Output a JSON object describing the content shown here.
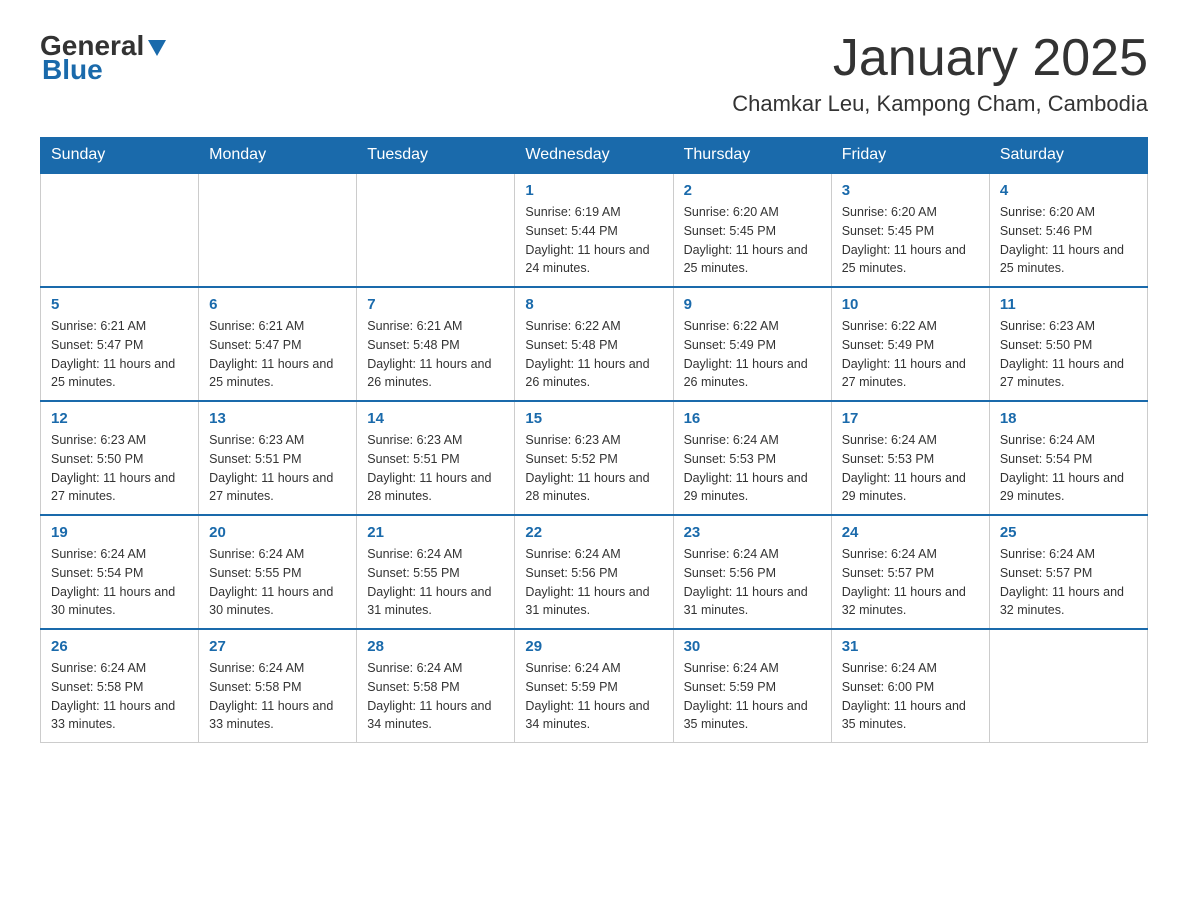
{
  "header": {
    "logo_general": "General",
    "logo_blue": "Blue",
    "month_title": "January 2025",
    "location": "Chamkar Leu, Kampong Cham, Cambodia"
  },
  "days_of_week": [
    "Sunday",
    "Monday",
    "Tuesday",
    "Wednesday",
    "Thursday",
    "Friday",
    "Saturday"
  ],
  "weeks": [
    [
      {
        "day": "",
        "info": ""
      },
      {
        "day": "",
        "info": ""
      },
      {
        "day": "",
        "info": ""
      },
      {
        "day": "1",
        "info": "Sunrise: 6:19 AM\nSunset: 5:44 PM\nDaylight: 11 hours and 24 minutes."
      },
      {
        "day": "2",
        "info": "Sunrise: 6:20 AM\nSunset: 5:45 PM\nDaylight: 11 hours and 25 minutes."
      },
      {
        "day": "3",
        "info": "Sunrise: 6:20 AM\nSunset: 5:45 PM\nDaylight: 11 hours and 25 minutes."
      },
      {
        "day": "4",
        "info": "Sunrise: 6:20 AM\nSunset: 5:46 PM\nDaylight: 11 hours and 25 minutes."
      }
    ],
    [
      {
        "day": "5",
        "info": "Sunrise: 6:21 AM\nSunset: 5:47 PM\nDaylight: 11 hours and 25 minutes."
      },
      {
        "day": "6",
        "info": "Sunrise: 6:21 AM\nSunset: 5:47 PM\nDaylight: 11 hours and 25 minutes."
      },
      {
        "day": "7",
        "info": "Sunrise: 6:21 AM\nSunset: 5:48 PM\nDaylight: 11 hours and 26 minutes."
      },
      {
        "day": "8",
        "info": "Sunrise: 6:22 AM\nSunset: 5:48 PM\nDaylight: 11 hours and 26 minutes."
      },
      {
        "day": "9",
        "info": "Sunrise: 6:22 AM\nSunset: 5:49 PM\nDaylight: 11 hours and 26 minutes."
      },
      {
        "day": "10",
        "info": "Sunrise: 6:22 AM\nSunset: 5:49 PM\nDaylight: 11 hours and 27 minutes."
      },
      {
        "day": "11",
        "info": "Sunrise: 6:23 AM\nSunset: 5:50 PM\nDaylight: 11 hours and 27 minutes."
      }
    ],
    [
      {
        "day": "12",
        "info": "Sunrise: 6:23 AM\nSunset: 5:50 PM\nDaylight: 11 hours and 27 minutes."
      },
      {
        "day": "13",
        "info": "Sunrise: 6:23 AM\nSunset: 5:51 PM\nDaylight: 11 hours and 27 minutes."
      },
      {
        "day": "14",
        "info": "Sunrise: 6:23 AM\nSunset: 5:51 PM\nDaylight: 11 hours and 28 minutes."
      },
      {
        "day": "15",
        "info": "Sunrise: 6:23 AM\nSunset: 5:52 PM\nDaylight: 11 hours and 28 minutes."
      },
      {
        "day": "16",
        "info": "Sunrise: 6:24 AM\nSunset: 5:53 PM\nDaylight: 11 hours and 29 minutes."
      },
      {
        "day": "17",
        "info": "Sunrise: 6:24 AM\nSunset: 5:53 PM\nDaylight: 11 hours and 29 minutes."
      },
      {
        "day": "18",
        "info": "Sunrise: 6:24 AM\nSunset: 5:54 PM\nDaylight: 11 hours and 29 minutes."
      }
    ],
    [
      {
        "day": "19",
        "info": "Sunrise: 6:24 AM\nSunset: 5:54 PM\nDaylight: 11 hours and 30 minutes."
      },
      {
        "day": "20",
        "info": "Sunrise: 6:24 AM\nSunset: 5:55 PM\nDaylight: 11 hours and 30 minutes."
      },
      {
        "day": "21",
        "info": "Sunrise: 6:24 AM\nSunset: 5:55 PM\nDaylight: 11 hours and 31 minutes."
      },
      {
        "day": "22",
        "info": "Sunrise: 6:24 AM\nSunset: 5:56 PM\nDaylight: 11 hours and 31 minutes."
      },
      {
        "day": "23",
        "info": "Sunrise: 6:24 AM\nSunset: 5:56 PM\nDaylight: 11 hours and 31 minutes."
      },
      {
        "day": "24",
        "info": "Sunrise: 6:24 AM\nSunset: 5:57 PM\nDaylight: 11 hours and 32 minutes."
      },
      {
        "day": "25",
        "info": "Sunrise: 6:24 AM\nSunset: 5:57 PM\nDaylight: 11 hours and 32 minutes."
      }
    ],
    [
      {
        "day": "26",
        "info": "Sunrise: 6:24 AM\nSunset: 5:58 PM\nDaylight: 11 hours and 33 minutes."
      },
      {
        "day": "27",
        "info": "Sunrise: 6:24 AM\nSunset: 5:58 PM\nDaylight: 11 hours and 33 minutes."
      },
      {
        "day": "28",
        "info": "Sunrise: 6:24 AM\nSunset: 5:58 PM\nDaylight: 11 hours and 34 minutes."
      },
      {
        "day": "29",
        "info": "Sunrise: 6:24 AM\nSunset: 5:59 PM\nDaylight: 11 hours and 34 minutes."
      },
      {
        "day": "30",
        "info": "Sunrise: 6:24 AM\nSunset: 5:59 PM\nDaylight: 11 hours and 35 minutes."
      },
      {
        "day": "31",
        "info": "Sunrise: 6:24 AM\nSunset: 6:00 PM\nDaylight: 11 hours and 35 minutes."
      },
      {
        "day": "",
        "info": ""
      }
    ]
  ]
}
